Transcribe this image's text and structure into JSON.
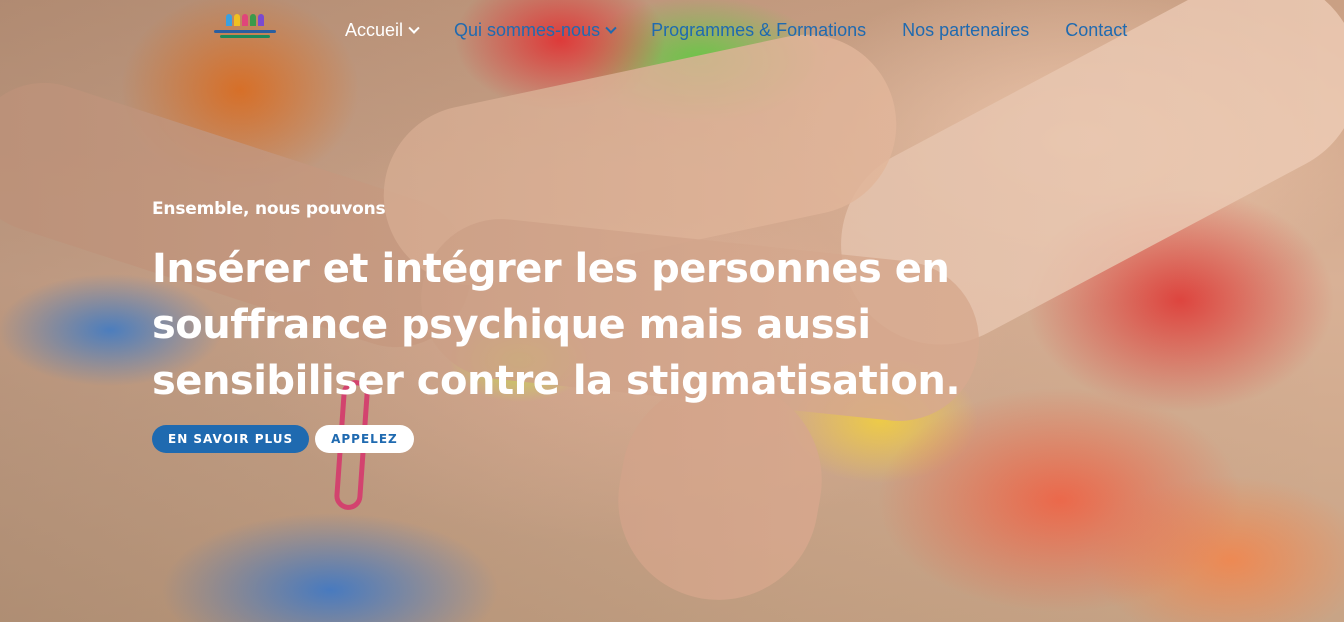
{
  "header": {
    "logo": {
      "name": "association-logo-icon",
      "colors": [
        "#3aa0e0",
        "#f0c020",
        "#e0457a",
        "#3a9a4a",
        "#7a4ad0"
      ]
    },
    "nav": [
      {
        "label": "Accueil",
        "dropdown": true,
        "active": true
      },
      {
        "label": "Qui sommes-nous",
        "dropdown": true,
        "active": false
      },
      {
        "label": "Programmes & Formations",
        "dropdown": false,
        "active": false
      },
      {
        "label": "Nos partenaires",
        "dropdown": false,
        "active": false
      },
      {
        "label": "Contact",
        "dropdown": false,
        "active": false
      }
    ]
  },
  "hero": {
    "kicker": "Ensemble, nous pouvons",
    "headline": "Insérer et intégrer les personnes en souffrance psychique mais aussi sensibiliser contre la stigmatisation.",
    "buttons": {
      "primary": "EN SAVOIR PLUS",
      "secondary": "APPELEZ"
    }
  },
  "colors": {
    "accent": "#1f6ab0",
    "text_on_image": "#ffffff"
  }
}
